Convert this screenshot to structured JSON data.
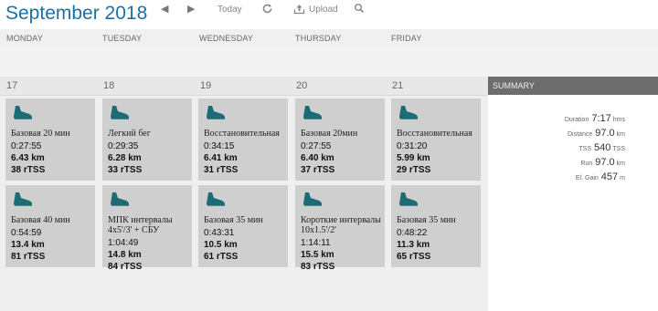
{
  "header": {
    "month_title": "September 2018",
    "today_label": "Today",
    "upload_label": "Upload"
  },
  "day_names": [
    "MONDAY",
    "TUESDAY",
    "WEDNESDAY",
    "THURSDAY",
    "FRIDAY"
  ],
  "dates": [
    "17",
    "18",
    "19",
    "20",
    "21"
  ],
  "summary": {
    "title": "SUMMARY",
    "rows": [
      {
        "label": "Duration",
        "value": "7:17",
        "unit": "hms"
      },
      {
        "label": "Distance",
        "value": "97.0",
        "unit": "km"
      },
      {
        "label": "TSS",
        "value": "540",
        "unit": "TSS"
      },
      {
        "label": "Run",
        "value": "97.0",
        "unit": "km"
      },
      {
        "label": "El. Gain",
        "value": "457",
        "unit": "m"
      }
    ]
  },
  "workouts": [
    [
      {
        "title": "Базовая 20 мин",
        "time": "0:27:55",
        "dist": "6.43",
        "tss": "38"
      },
      {
        "title": "Базовая 40 мин",
        "time": "0:54:59",
        "dist": "13.4",
        "tss": "81"
      }
    ],
    [
      {
        "title": "Легкий бег",
        "time": "0:29:35",
        "dist": "6.28",
        "tss": "33"
      },
      {
        "title": "МПК интервалы 4x5'/3' + СБУ",
        "time": "1:04:49",
        "dist": "14.8",
        "tss": "84"
      }
    ],
    [
      {
        "title": "Восстановительная",
        "time": "0:34:15",
        "dist": "6.41",
        "tss": "31"
      },
      {
        "title": "Базовая 35 мин",
        "time": "0:43:31",
        "dist": "10.5",
        "tss": "61"
      }
    ],
    [
      {
        "title": "Базовая 20мин",
        "time": "0:27:55",
        "dist": "6.40",
        "tss": "37"
      },
      {
        "title": "Короткие интервалы 10x1.5'/2'",
        "time": "1:14:11",
        "dist": "15.5",
        "tss": "83"
      }
    ],
    [
      {
        "title": "Восстановительная",
        "time": "0:31:20",
        "dist": "5.99",
        "tss": "29"
      },
      {
        "title": "Базовая 35 мин",
        "time": "0:48:22",
        "dist": "11.3",
        "tss": "65"
      }
    ]
  ],
  "units": {
    "distance": "km",
    "tss": "rTSS"
  },
  "colors": {
    "title_blue": "#1f6fa6",
    "shoe_icon": "#1d6b74",
    "card_bg": "#cfcfcf",
    "summary_header": "#6d6d6d"
  }
}
